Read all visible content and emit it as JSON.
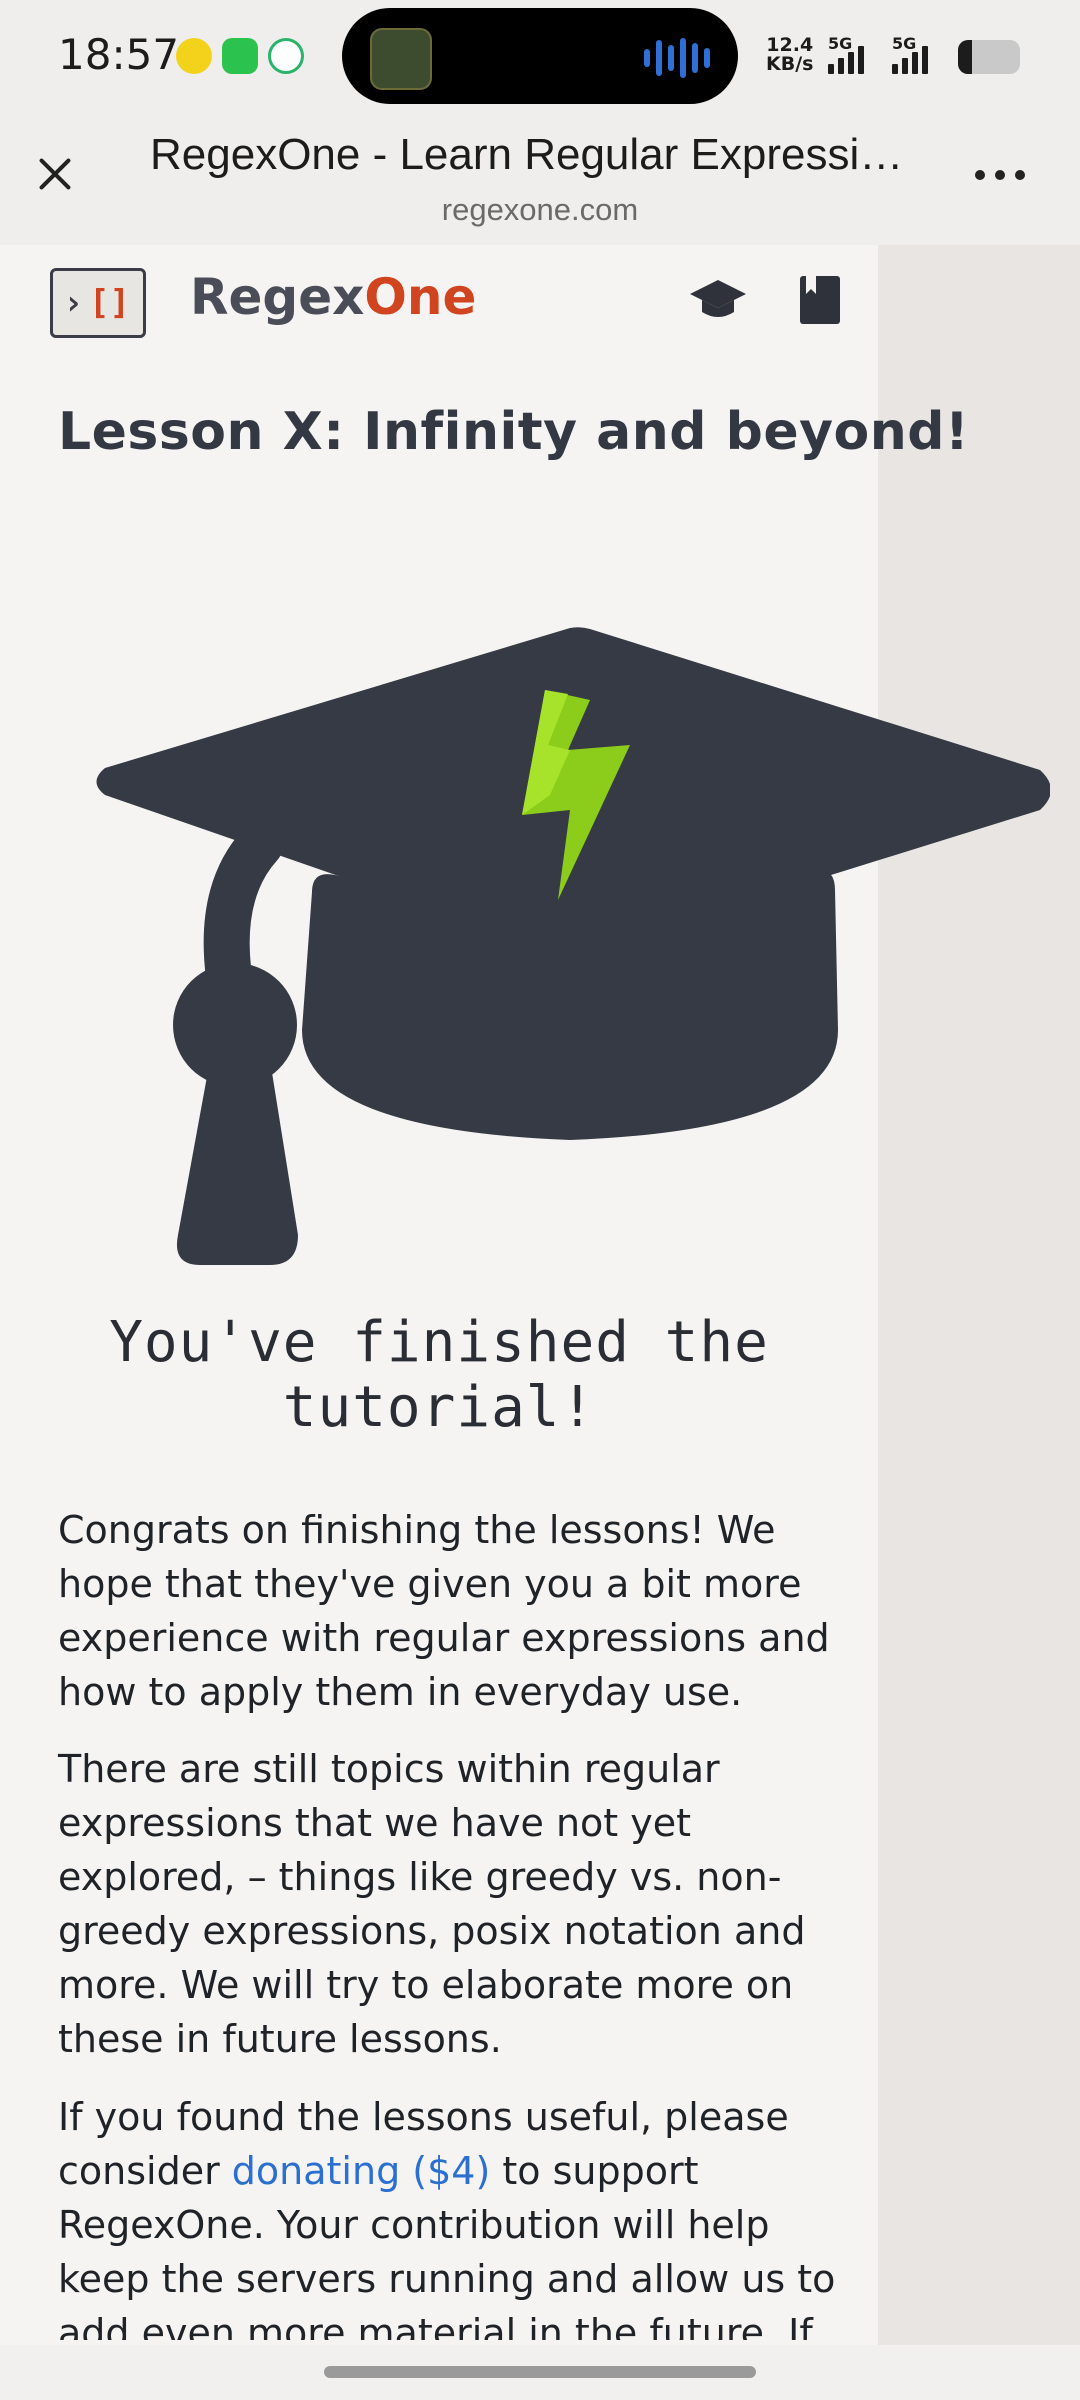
{
  "status_bar": {
    "time": "18:57",
    "net_speed_value": "12.4",
    "net_speed_unit": "KB/s",
    "signal1_label": "5G",
    "signal2_label": "5G"
  },
  "browser": {
    "page_title": "RegexOne - Learn Regular Expressions with simple, interactive exercises",
    "url": "regexone.com"
  },
  "site": {
    "brand_part1": "Regex",
    "brand_part2": "One",
    "logo_chevron": "›",
    "logo_brackets": "[]",
    "colors": {
      "accent": "#d0441f",
      "dark": "#3a3d45",
      "link": "#2b6fd1",
      "bolt": "#8ccc1a"
    }
  },
  "lesson": {
    "title": "Lesson X: Infinity and beyond!",
    "finished_heading": "You've finished the tutorial!",
    "para1": "Congrats on finishing the lessons! We hope that they've given you a bit more experience with regular expressions and how to apply them in everyday use.",
    "para2": "There are still topics within regular expressions that we have not yet explored, – things like greedy vs. non-greedy expressions, posix notation and more. We will try to elaborate more on these in future lessons.",
    "para3_before": "If you found the lessons useful, please consider ",
    "para3_link": "donating ($4)",
    "para3_after": " to support RegexOne. Your contribution will help keep the servers running and allow us to add even more material in the future. If you"
  }
}
